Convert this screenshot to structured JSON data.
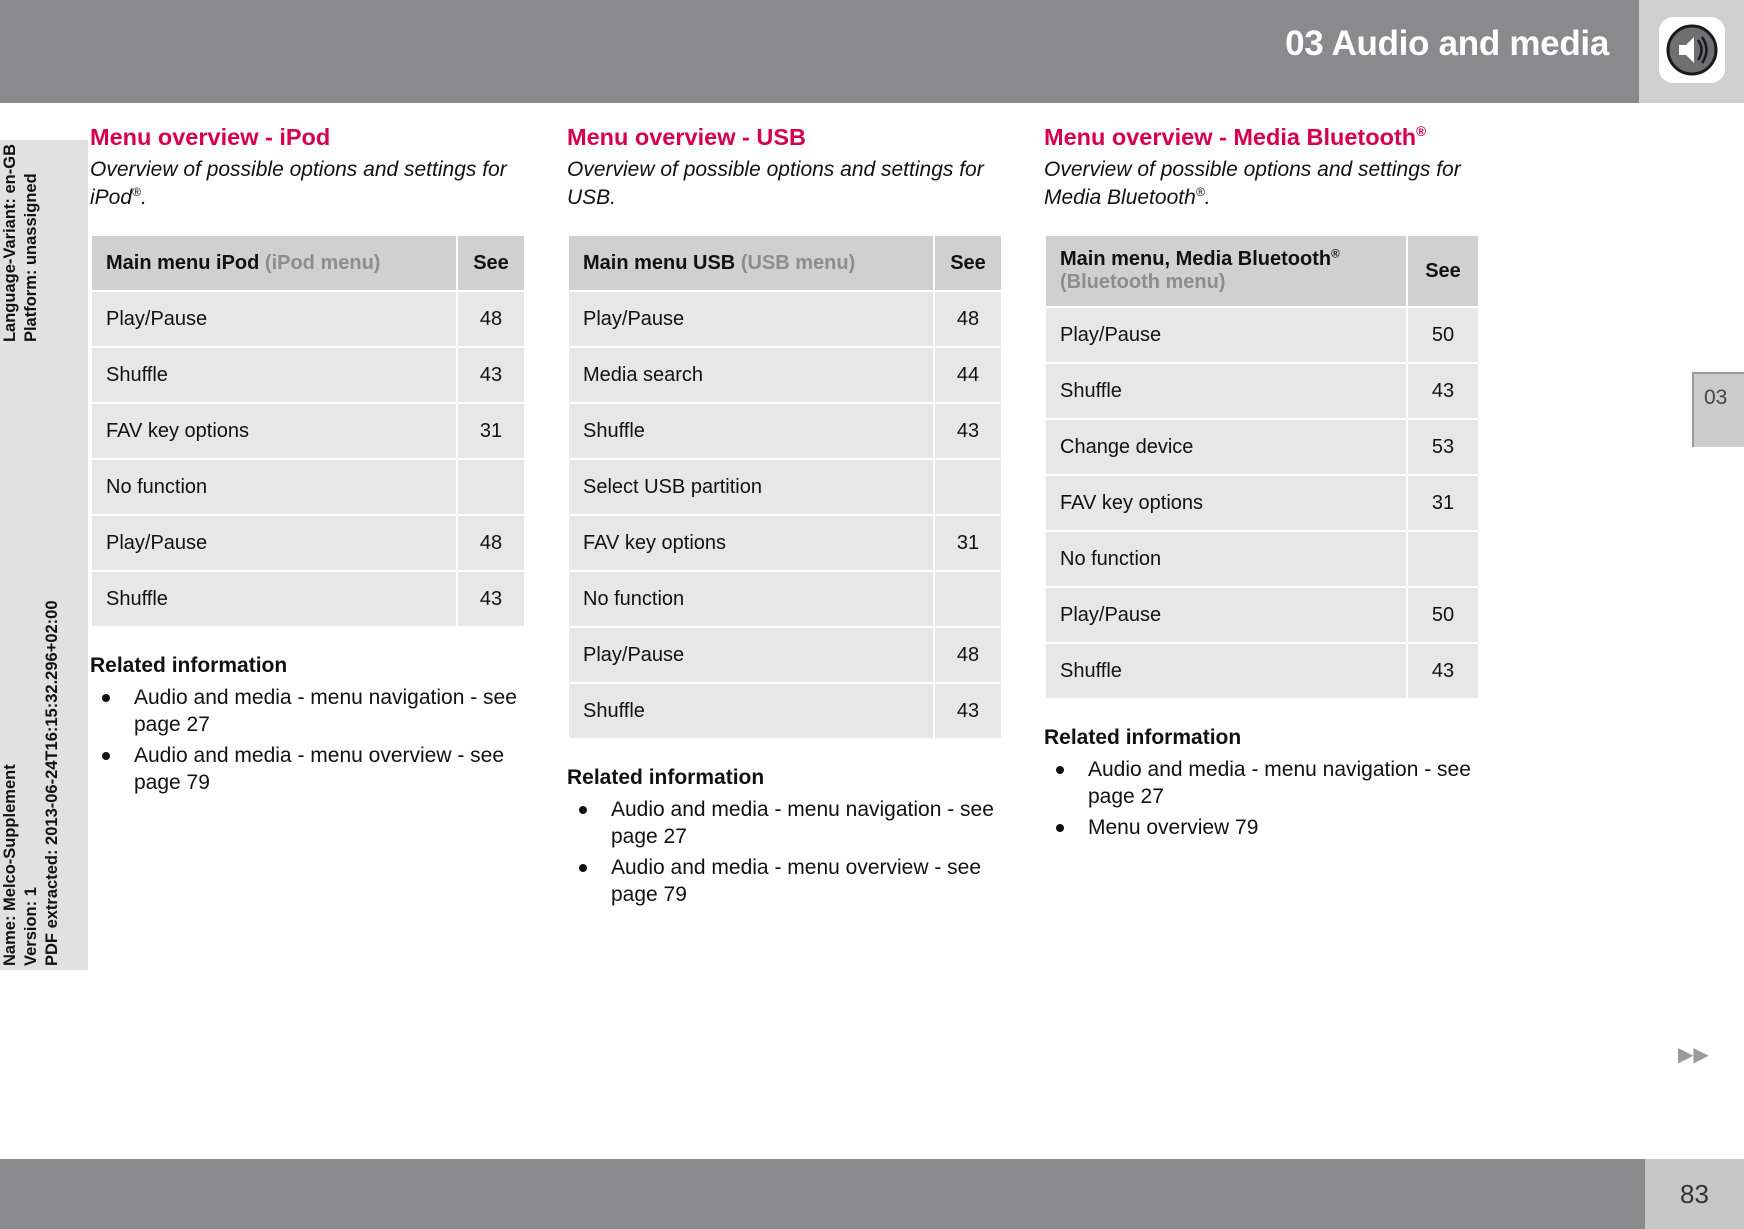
{
  "header": {
    "title": "03 Audio and media",
    "icon": "speaker-icon"
  },
  "meta_strip": {
    "left_group": [
      "Name: Melco-Supplement",
      "Version: 1",
      "PDF extracted: 2013-06-24T16:15:32.296+02:00"
    ],
    "right_group": [
      "Language-Variant: en-GB",
      "Platform: unassigned"
    ]
  },
  "columns": [
    {
      "id": "ipod",
      "title": "Menu overview - iPod",
      "subtitle_pre": "Overview of possible options and settings for iPod",
      "subtitle_sup": "®",
      "subtitle_post": ".",
      "table": {
        "header_main": "Main menu iPod",
        "header_main_dim": "(iPod menu)",
        "header_see": "See",
        "rows": [
          {
            "label": "Play/Pause",
            "level": 0,
            "see": "48"
          },
          {
            "label": "Shuffle",
            "level": 0,
            "see": "43"
          },
          {
            "label": "FAV key options",
            "level": 0,
            "see": "31"
          },
          {
            "label": "No function",
            "level": 1,
            "see": ""
          },
          {
            "label": "Play/Pause",
            "level": 1,
            "see": "48"
          },
          {
            "label": "Shuffle",
            "level": 1,
            "see": "43"
          }
        ]
      },
      "related": {
        "title": "Related information",
        "items": [
          "Audio and media - menu navigation - see page 27",
          "Audio and media - menu overview - see page 79"
        ]
      }
    },
    {
      "id": "usb",
      "title": "Menu overview - USB",
      "subtitle_pre": "Overview of possible options and settings for USB.",
      "subtitle_sup": "",
      "subtitle_post": "",
      "table": {
        "header_main": "Main menu USB",
        "header_main_dim": "(USB menu)",
        "header_see": "See",
        "rows": [
          {
            "label": "Play/Pause",
            "level": 0,
            "see": "48"
          },
          {
            "label": "Media search",
            "level": 0,
            "see": "44"
          },
          {
            "label": "Shuffle",
            "level": 0,
            "see": "43"
          },
          {
            "label": "Select USB partition",
            "level": 0,
            "see": ""
          },
          {
            "label": "FAV key options",
            "level": 0,
            "see": "31"
          },
          {
            "label": "No function",
            "level": 1,
            "see": ""
          },
          {
            "label": "Play/Pause",
            "level": 1,
            "see": "48"
          },
          {
            "label": "Shuffle",
            "level": 1,
            "see": "43"
          }
        ]
      },
      "related": {
        "title": "Related information",
        "items": [
          "Audio and media - menu navigation - see page 27",
          "Audio and media - menu overview - see page 79"
        ]
      }
    },
    {
      "id": "bt",
      "title_pre": "Menu overview - Media Bluetooth",
      "title_sup": "®",
      "title": "Menu overview - Media Bluetooth®",
      "subtitle_pre": "Overview of possible options and settings for Media Bluetooth",
      "subtitle_sup": "®",
      "subtitle_post": ".",
      "table": {
        "header_main": "Main menu, Media Bluetooth",
        "header_main_sup": "®",
        "header_main_dim": "(Bluetooth menu)",
        "header_see": "See",
        "rows": [
          {
            "label": "Play/Pause",
            "level": 0,
            "see": "50"
          },
          {
            "label": "Shuffle",
            "level": 0,
            "see": "43"
          },
          {
            "label": "Change device",
            "level": 0,
            "see": "53"
          },
          {
            "label": "FAV key options",
            "level": 0,
            "see": "31"
          },
          {
            "label": "No function",
            "level": 1,
            "see": ""
          },
          {
            "label": "Play/Pause",
            "level": 1,
            "see": "50"
          },
          {
            "label": "Shuffle",
            "level": 1,
            "see": "43"
          }
        ]
      },
      "related": {
        "title": "Related information",
        "items": [
          "Audio and media - menu navigation - see page 27",
          "Menu overview 79"
        ]
      }
    }
  ],
  "chapter_tab": "03",
  "footer": {
    "page_number": "83",
    "arrows": "▶▶"
  },
  "colors": {
    "accent": "#d6004e",
    "header_bar": "#8a8a8c",
    "table_header": "#d0d0d0",
    "table_row": "#e7e7e7",
    "dim_text": "#8d8d8d"
  }
}
